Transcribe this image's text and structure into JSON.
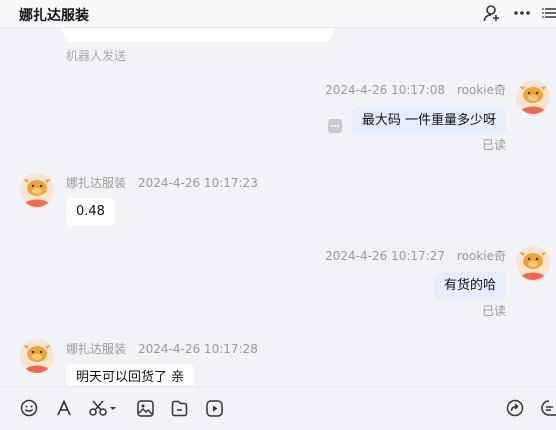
{
  "header": {
    "title": "娜扎达服装",
    "icons": [
      "add-user-icon",
      "more-icon",
      "list-icon"
    ]
  },
  "chat": {
    "prev_note": "机器人发送",
    "messages": [
      {
        "direction": "out",
        "name": "rookie奇",
        "time": "2024-4-26 10:17:08",
        "text": "最大码 一件重量多少呀",
        "status": "已读"
      },
      {
        "direction": "in",
        "name": "娜扎达服装",
        "time": "2024-4-26 10:17:23",
        "text": "0.48"
      },
      {
        "direction": "out",
        "name": "rookie奇",
        "time": "2024-4-26 10:17:27",
        "text": "有货的哈",
        "status": "已读"
      },
      {
        "direction": "in",
        "name": "娜扎达服装",
        "time": "2024-4-26 10:17:28",
        "text": "明天可以回货了 亲"
      }
    ]
  },
  "toolbar": {
    "icons": [
      "emoji-icon",
      "font-icon",
      "scissors-icon",
      "image-icon",
      "folder-icon",
      "video-icon",
      "share-icon",
      "quick-reply-icon"
    ]
  },
  "colors": {
    "out_bubble": "#e6edfd",
    "in_bubble": "#ffffff",
    "avatar_bg": "#f7e6d6",
    "avatar_face": "#f0a531",
    "avatar_body": "#ef6a4a"
  }
}
